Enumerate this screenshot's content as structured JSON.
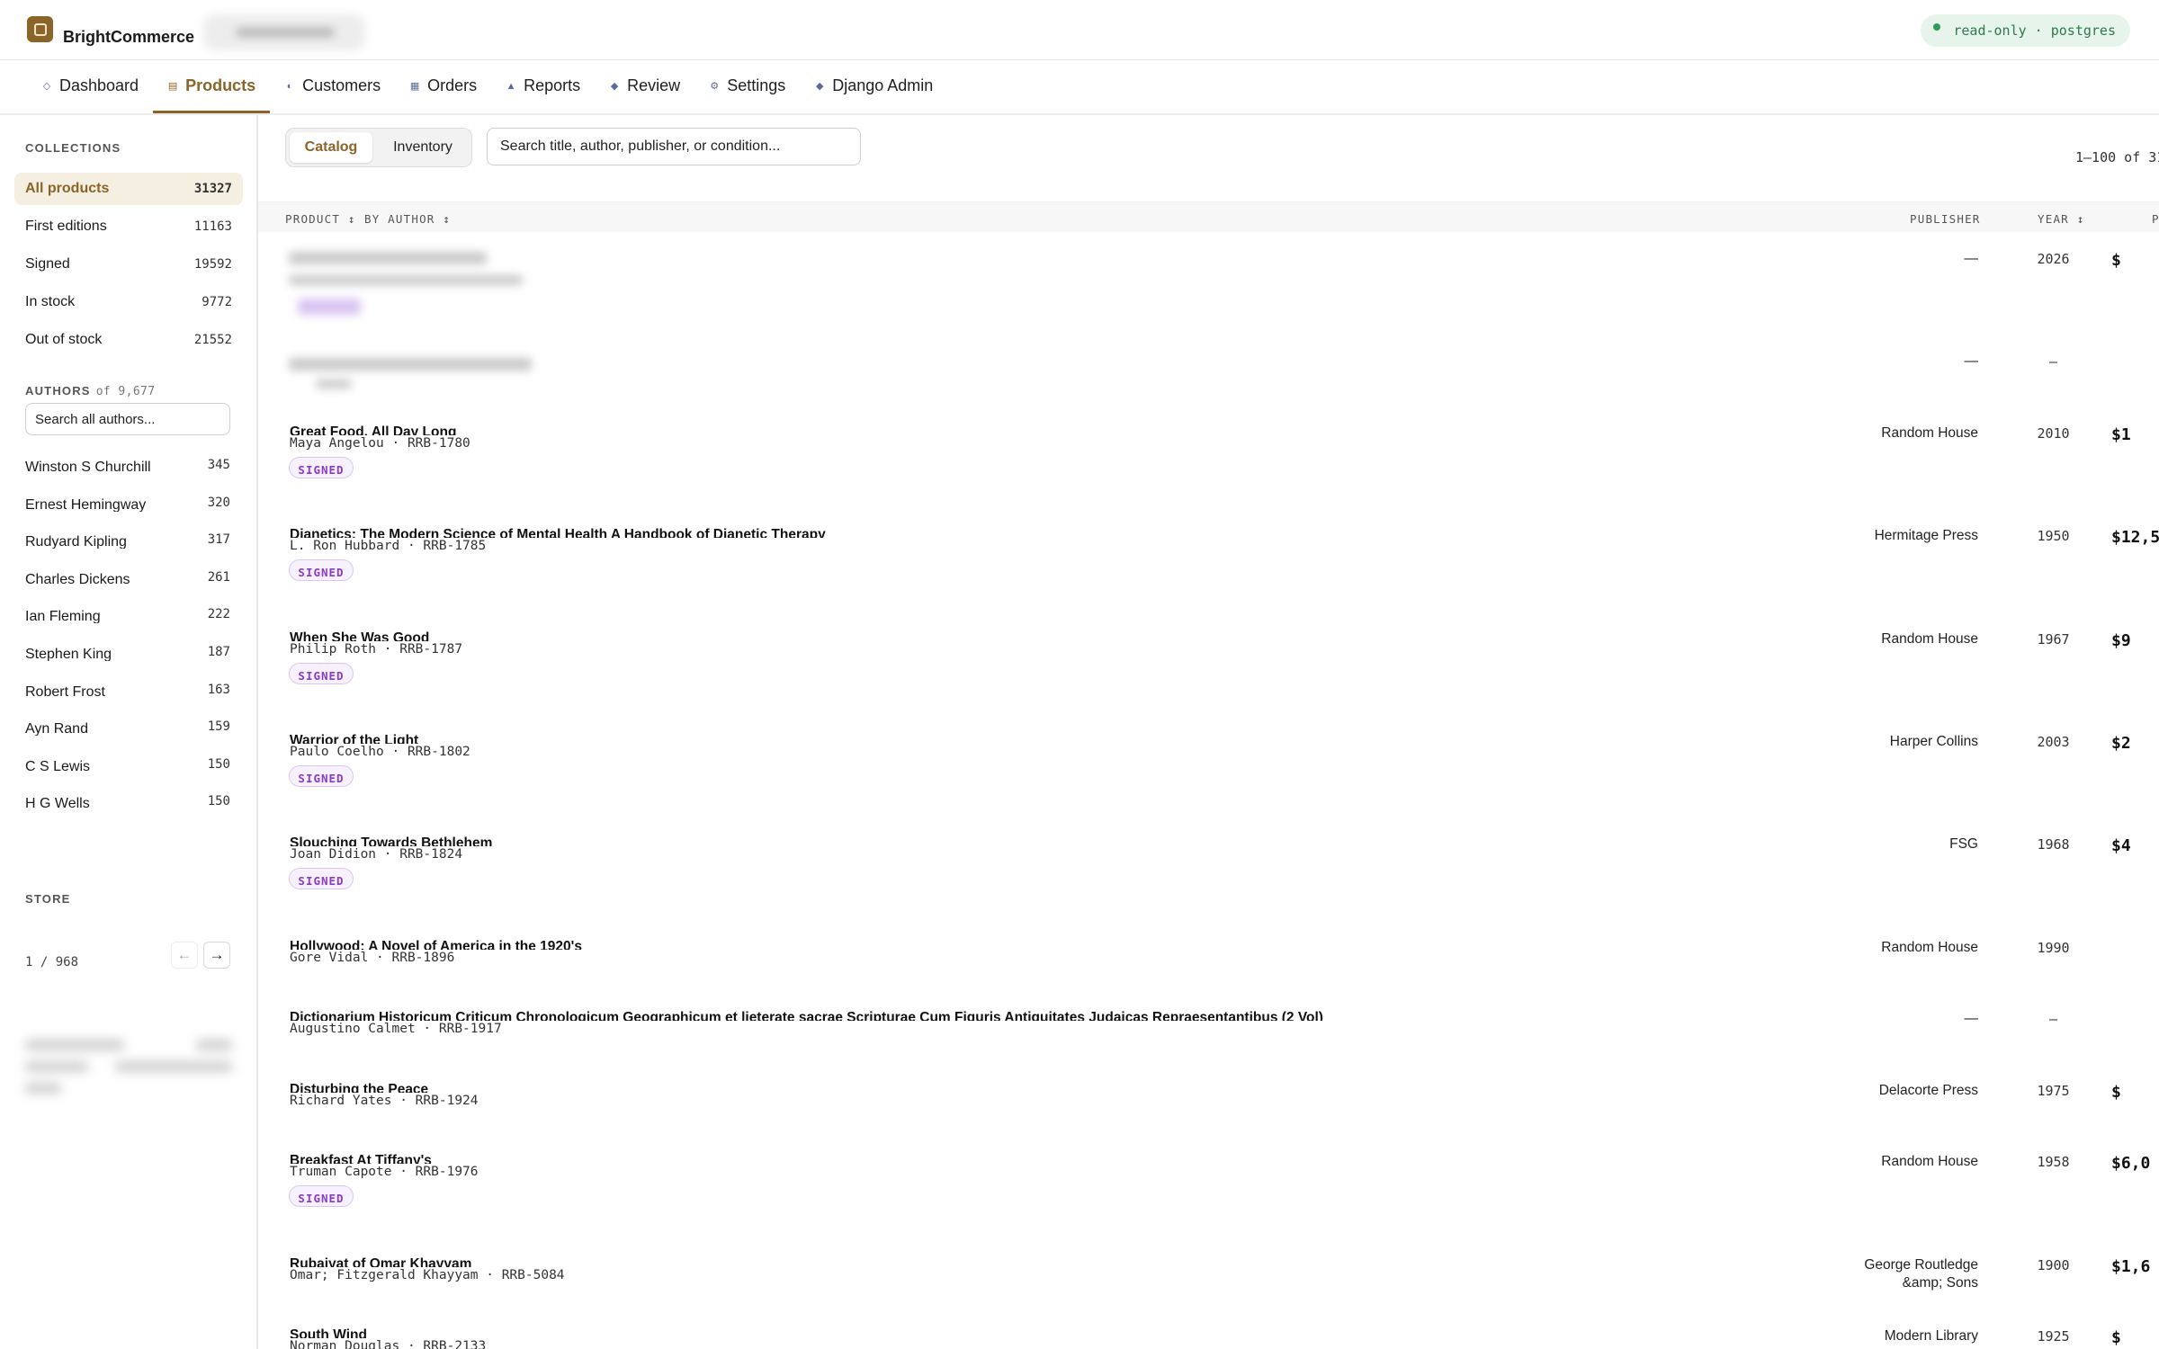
{
  "brand": "BrightCommerce",
  "status": "read-only · postgres",
  "nav": [
    {
      "label": "Dashboard",
      "icon": "◇",
      "name": "dashboard",
      "active": false
    },
    {
      "label": "Products",
      "icon": "▤",
      "name": "products",
      "active": true
    },
    {
      "label": "Customers",
      "icon": "◐",
      "name": "customers",
      "active": false
    },
    {
      "label": "Orders",
      "icon": "▦",
      "name": "orders",
      "active": false
    },
    {
      "label": "Reports",
      "icon": "▲",
      "name": "reports",
      "active": false
    },
    {
      "label": "Review",
      "icon": "◆",
      "name": "review",
      "active": false
    },
    {
      "label": "Settings",
      "icon": "⚙",
      "name": "settings",
      "active": false
    },
    {
      "label": "Django Admin",
      "icon": "◆",
      "name": "django-admin",
      "active": false
    }
  ],
  "sidebar": {
    "collections_label": "COLLECTIONS",
    "collections": [
      {
        "label": "All products",
        "count": "31327",
        "active": true
      },
      {
        "label": "First editions",
        "count": "11163"
      },
      {
        "label": "Signed",
        "count": "19592"
      },
      {
        "label": "In stock",
        "count": "9772"
      },
      {
        "label": "Out of stock",
        "count": "21552"
      }
    ],
    "authors_label": "AUTHORS",
    "authors_total": "of 9,677",
    "author_search_placeholder": "Search all authors...",
    "authors": [
      {
        "name": "Winston S Churchill",
        "count": "345"
      },
      {
        "name": "Ernest Hemingway",
        "count": "320"
      },
      {
        "name": "Rudyard Kipling",
        "count": "317"
      },
      {
        "name": "Charles Dickens",
        "count": "261"
      },
      {
        "name": "Ian Fleming",
        "count": "222"
      },
      {
        "name": "Stephen King",
        "count": "187"
      },
      {
        "name": "Robert Frost",
        "count": "163"
      },
      {
        "name": "Ayn Rand",
        "count": "159"
      },
      {
        "name": "C S Lewis",
        "count": "150"
      },
      {
        "name": "H G Wells",
        "count": "150"
      }
    ],
    "pager": "1 / 968",
    "store_label": "STORE"
  },
  "main": {
    "segments": {
      "catalog": "Catalog",
      "inventory": "Inventory"
    },
    "search_placeholder": "Search title, author, publisher, or condition...",
    "range": "1–100 of 31",
    "headers": {
      "product": "PRODUCT ↕",
      "by_author": "BY AUTHOR ↕",
      "publisher": "PUBLISHER",
      "year": "YEAR ↕",
      "price": "P"
    },
    "rows": [
      {
        "title": "",
        "meta": "",
        "signed": true,
        "publisher": "—",
        "year": "2026",
        "price": "$",
        "blurred": true
      },
      {
        "title": "",
        "meta": "",
        "signed": false,
        "publisher": "—",
        "year": "—",
        "price": "",
        "blurred": true
      },
      {
        "title": "Great Food, All Day Long",
        "meta": "Maya Angelou · RRB-1780",
        "signed": true,
        "publisher": "Random House",
        "year": "2010",
        "price": "$1"
      },
      {
        "title": "Dianetics: The Modern Science of Mental Health A Handbook of Dianetic Therapy",
        "meta": "L. Ron Hubbard · RRB-1785",
        "signed": true,
        "publisher": "Hermitage Press",
        "year": "1950",
        "price": "$12,5"
      },
      {
        "title": "When She Was Good",
        "meta": "Philip Roth · RRB-1787",
        "signed": true,
        "publisher": "Random House",
        "year": "1967",
        "price": "$9"
      },
      {
        "title": "Warrior of the Light",
        "meta": "Paulo Coelho · RRB-1802",
        "signed": true,
        "publisher": "Harper Collins",
        "year": "2003",
        "price": "$2"
      },
      {
        "title": "Slouching Towards Bethlehem",
        "meta": "Joan Didion · RRB-1824",
        "signed": true,
        "publisher": "FSG",
        "year": "1968",
        "price": "$4"
      },
      {
        "title": "Hollywood: A Novel of America in the 1920's",
        "meta": "Gore Vidal · RRB-1896",
        "signed": false,
        "publisher": "Random House",
        "year": "1990",
        "price": ""
      },
      {
        "title": "Dictionarium Historicum Criticum Chronologicum Geographicum et lieterate sacrae Scripturae Cum Figuris Antiquitates Judaicas Repraesentantibus (2 Vol)",
        "meta": "Augustino Calmet · RRB-1917",
        "signed": false,
        "publisher": "—",
        "year": "—",
        "price": ""
      },
      {
        "title": "Disturbing the Peace",
        "meta": "Richard Yates · RRB-1924",
        "signed": false,
        "publisher": "Delacorte Press",
        "year": "1975",
        "price": "$"
      },
      {
        "title": "Breakfast At Tiffany's",
        "meta": "Truman Capote · RRB-1976",
        "signed": true,
        "publisher": "Random House",
        "year": "1958",
        "price": "$6,0"
      },
      {
        "title": "Rubaiyat of Omar Khayyam",
        "meta": "Omar; Fitzgerald Khayyam · RRB-5084",
        "signed": false,
        "publisher": "George Routledge\n&amp; Sons",
        "year": "1900",
        "price": "$1,6"
      },
      {
        "title": "South Wind",
        "meta": "Norman Douglas · RRB-2133",
        "signed": false,
        "publisher": "Modern Library",
        "year": "1925",
        "price": "$"
      }
    ],
    "signed_label": "SIGNED"
  },
  "colors": {
    "accent": "#8a6428",
    "signed": "#8a3bc9",
    "status_green": "#2f7a4a"
  }
}
